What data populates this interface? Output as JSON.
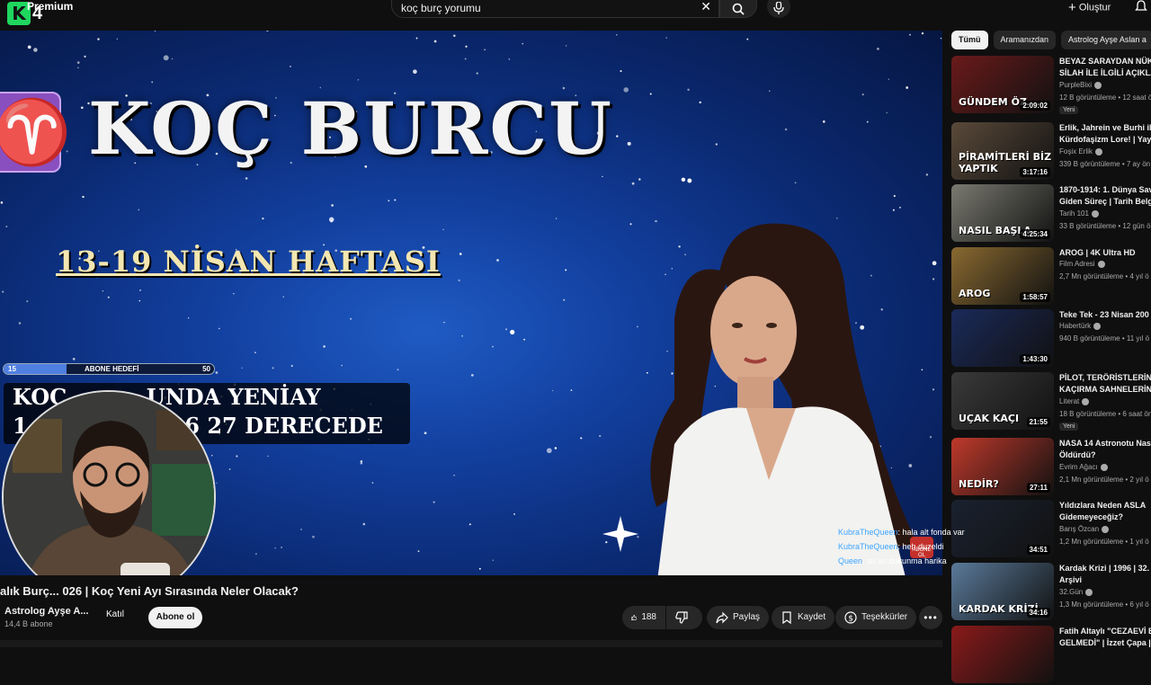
{
  "header": {
    "logo_letter": "K",
    "logo_number": "4",
    "premium_label": "Premium",
    "search_value": "koç burç yorumu",
    "create_label": "Oluştur"
  },
  "player": {
    "aries_symbol": "♈",
    "title": "KOÇ BURCU",
    "subtitle": "13-19 NİSAN HAFTASI",
    "banner_line1": "KOÇ ",
    "banner_line1_end": "UNDA YENİAY",
    "banner_line2": "1",
    "banner_line2_end": "26 27 DERECEDE",
    "goal_start": "15",
    "goal_label": "ABONE HEDEFİ",
    "goal_end": "50",
    "goal_progress": 0.3,
    "sub_badge_text": "ABONE OL",
    "chat": [
      {
        "user": "KubraTheQueen",
        "message": ": hala alt fonda var"
      },
      {
        "user": "KubraTheQueen",
        "message": ": heh duzeldi"
      },
      {
        "user": "Queen",
        "message": ": su an dokunma harika"
      }
    ]
  },
  "video_info": {
    "title": "alık Burç... 026 | Koç Yeni Ayı Sırasında Neler Olacak?",
    "channel": "Astrolog Ayşe A...",
    "subscribers": "14,4 B abone",
    "join_label": "Katıl",
    "subscribe_label": "Abone ol",
    "likes": "188",
    "share_label": "Paylaş",
    "save_label": "Kaydet",
    "thanks_label": "Teşekkürler"
  },
  "chips": [
    "Tümü",
    "Aramanızdan",
    "Astrolog Ayşe Aslan a"
  ],
  "recommendations": [
    {
      "title1": "BEYAZ SARAYDAN NÜKL",
      "title2": "SİLAH İLE İLGİLİ AÇIKLA",
      "channel": "PurpleBixi",
      "meta": "12 B görüntüleme • 12 saat ö",
      "duration": "2:09:02",
      "thumb_text": "GÜNDEM ÖZ",
      "badge": "Yeni",
      "color": "#6b1a1a"
    },
    {
      "title1": "Erlik, Jahrein ve Burhi ile",
      "title2": "Kürdofaşizm Lore! | Yayı",
      "channel": "Foşix Erlik",
      "meta": "339 B görüntüleme • 7 ay ön",
      "duration": "3:17:16",
      "thumb_text": "PİRAMİTLERİ BİZ YAPTIK",
      "badge": "",
      "color": "#5a4a3a"
    },
    {
      "title1": "1870-1914: 1. Dünya Sav",
      "title2": "Giden Süreç | Tarih Belge",
      "channel": "Tarih 101",
      "meta": "33 B görüntüleme • 12 gün ö",
      "duration": "4:25:34",
      "thumb_text": "NASIL BAŞLA",
      "badge": "",
      "color": "#7a7a70"
    },
    {
      "title1": "AROG | 4K Ultra HD",
      "title2": "",
      "channel": "Film Adresi",
      "meta": "2,7 Mn görüntüleme • 4 yıl ö",
      "duration": "1:58:57",
      "thumb_text": "AROG",
      "badge": "",
      "color": "#8a6a30"
    },
    {
      "title1": "Teke Tek - 23 Nisan 200",
      "title2": "",
      "channel": "Habertürk",
      "meta": "940 B görüntüleme • 11 yıl ö",
      "duration": "1:43:30",
      "thumb_text": "",
      "badge": "",
      "color": "#1a2a5a"
    },
    {
      "title1": "PİLOT, TERÖRİSTLERİN U",
      "title2": "KAÇIRMA SAHNELERİNİ",
      "channel": "Literat",
      "meta": "18 B görüntüleme • 6 saat ön",
      "duration": "21:55",
      "thumb_text": "UÇAK KAÇI",
      "badge": "Yeni",
      "color": "#3a3a3a"
    },
    {
      "title1": "NASA 14 Astronotu Nasıl",
      "title2": "Öldürdü?",
      "channel": "Evrim Ağacı",
      "meta": "2,1 Mn görüntüleme • 2 yıl ö",
      "duration": "27:11",
      "thumb_text": "NEDİR?",
      "badge": "",
      "color": "#c0392b"
    },
    {
      "title1": "Yıldızlara Neden ASLA",
      "title2": "Gidemeyeceğiz?",
      "channel": "Barış Özcan",
      "meta": "1,2 Mn görüntüleme • 1 yıl ö",
      "duration": "34:51",
      "thumb_text": "",
      "badge": "",
      "color": "#1a2230"
    },
    {
      "title1": "Kardak Krizi | 1996 | 32.",
      "title2": "Arşivi",
      "channel": "32.Gün",
      "meta": "1,3 Mn görüntüleme • 6 yıl ö",
      "duration": "34:16",
      "thumb_text": "KARDAK KRİZİ",
      "badge": "",
      "color": "#5a7a9a"
    },
    {
      "title1": "Fatih Altaylı \"CEZAEVİ BA",
      "title2": "GELMEDİ\" | İzzet Çapa |",
      "channel": "",
      "meta": "",
      "duration": "",
      "thumb_text": "",
      "badge": "",
      "color": "#8a1a1a"
    }
  ]
}
